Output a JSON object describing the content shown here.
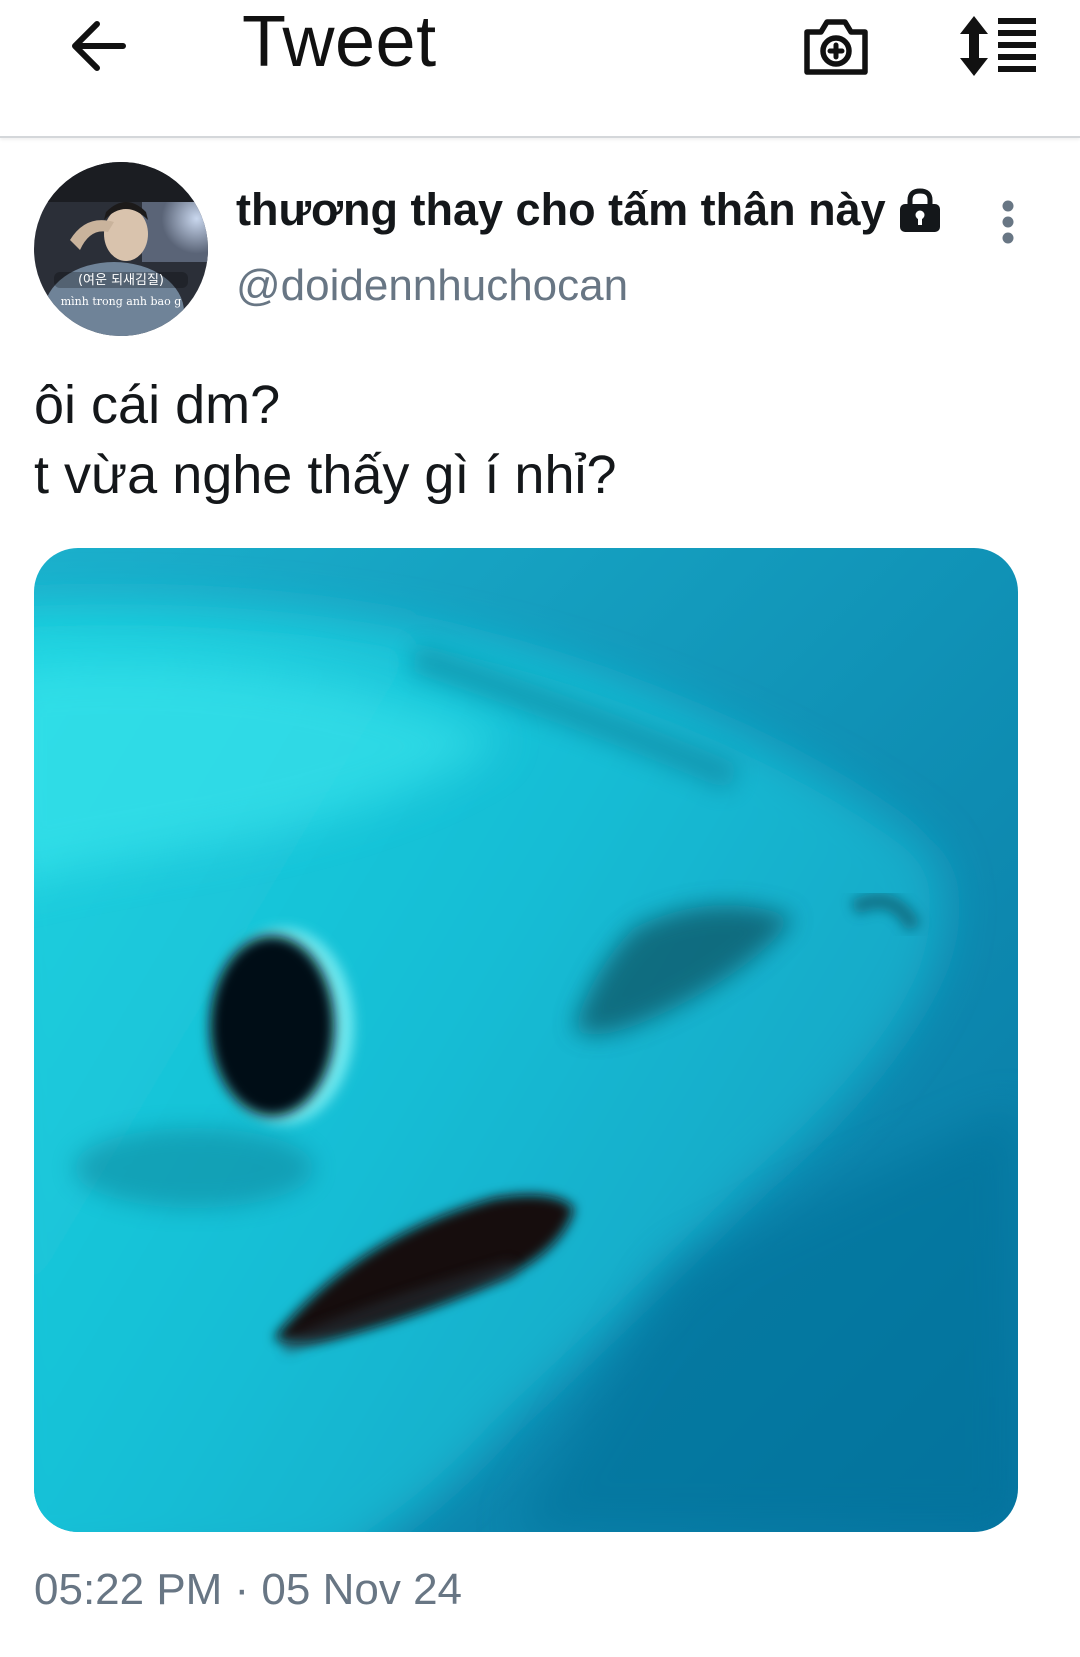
{
  "header": {
    "title": "Tweet",
    "back_icon": "arrow-left-icon",
    "camera_icon": "camera-plus-icon",
    "sort_icon": "sort-list-icon"
  },
  "author": {
    "display_name": "thương thay cho tấm thân này",
    "handle": "@doidennhuchocan",
    "protected_icon": "lock-icon",
    "avatar_caption_top": "(여운 되새김질)",
    "avatar_caption_bottom": "mình trong anh bao g"
  },
  "tweet": {
    "lines": [
      "ôi cái dm?",
      "t vừa nghe thấy gì í nhỉ?"
    ],
    "media": {
      "type": "photo",
      "subject": "shark-face"
    },
    "timestamp": "05:22 PM · 05 Nov 24",
    "more_icon": "more-vertical-icon"
  },
  "colors": {
    "text": "#14171a",
    "secondary_text": "#687684",
    "divider": "#d4d7da",
    "media_water": "#1ba8c8"
  }
}
